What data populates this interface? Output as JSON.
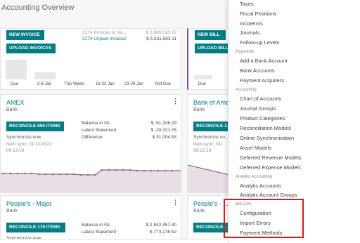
{
  "page": {
    "title": "Accounting Overview"
  },
  "card_invoices": {
    "new_label": "NEW INVOICE",
    "upload_label": "UPLOAD INVOICES",
    "stat_unpaid_partial": "2174 Invoices to Va...",
    "stat_unpaid_partial_amount": "$ 0,945,020.72",
    "unpaid_label": "2174 Unpaid Invoices",
    "unpaid_amount": "$ 5,331,563.11",
    "bars": [
      0.62,
      0.22,
      0.0,
      0.0,
      0.0,
      0.0
    ],
    "axis": [
      "Due",
      "2-8 Jan",
      "This Week",
      "16-22 Jan",
      "23-29 Jan",
      "Not Due"
    ],
    "colors": {
      "accent": "#017e84",
      "bar": "#e7e7e9"
    }
  },
  "card_bills": {
    "new_label": "NEW BILL",
    "upload_label": "UPLOAD BILLS",
    "axis": [
      "Due"
    ]
  },
  "card_amex": {
    "title": "AMEX",
    "subtitle": "Bank",
    "reconcile_label": "RECONCILE 850 ITEMS",
    "sync_label": "Synchronize now",
    "next_sync": "Next sync: 01/12/2022",
    "next_sync_time": "09:12:19",
    "balance_gl_label": "Balance in GL",
    "balance_gl_value": "$ -51,326.29",
    "latest_statement_label": "Latest Statement",
    "latest_statement_value": "$ -20,321.76",
    "difference_label": "Difference",
    "difference_value": "$ 31,004.53"
  },
  "card_bank_of_america": {
    "title": "Bank of Ame...",
    "subtitle": "Bank",
    "reconcile_label": "RECONCILE 2...",
    "sync_label": "Synchronize no...",
    "next_sync": "Next sync: 01/...",
    "next_sync_time": "09:12:19"
  },
  "card_peoples_major": {
    "title": "People's - Major",
    "subtitle": "Bank",
    "reconcile_label": "RECONCILE 179 ITEMS",
    "balance_gl_label": "Balance in GL",
    "balance_gl_value": "$ 2,842,457.40",
    "latest_statement_label": "Latest Statement",
    "latest_statement_value": "$ 773,176.52",
    "sync_label": "Synchronize now"
  },
  "card_peoples_right": {
    "title": "People's - ...",
    "subtitle": "Bank",
    "reconcile_label": "RECONCILE..."
  },
  "dropdown": {
    "top_items": [
      "Taxes",
      "Fiscal Positions",
      "Incoterms",
      "Journals",
      "Follow-up Levels"
    ],
    "payments_header": "Payments",
    "payments_items": [
      "Add a Bank Account",
      "Bank Accounts",
      "Payment Acquirers"
    ],
    "accounting_header": "Accounting",
    "accounting_items": [
      "Chart of Accounts",
      "Journal Groups",
      "Product Categories",
      "Reconciliation Models",
      "Online Synchronization",
      "Asset Models",
      "Deferred Revenue Models",
      "Deferred Expense Models"
    ],
    "analytic_header": "Analytic Accounting",
    "analytic_items": [
      "Analytic Accounts",
      "Analytic Account Groups"
    ],
    "billcom_header": "Bill.Com",
    "billcom_items": [
      "Configuration",
      "Import Errors",
      "Payment Methods"
    ],
    "highlight_color": "#e0181b"
  }
}
